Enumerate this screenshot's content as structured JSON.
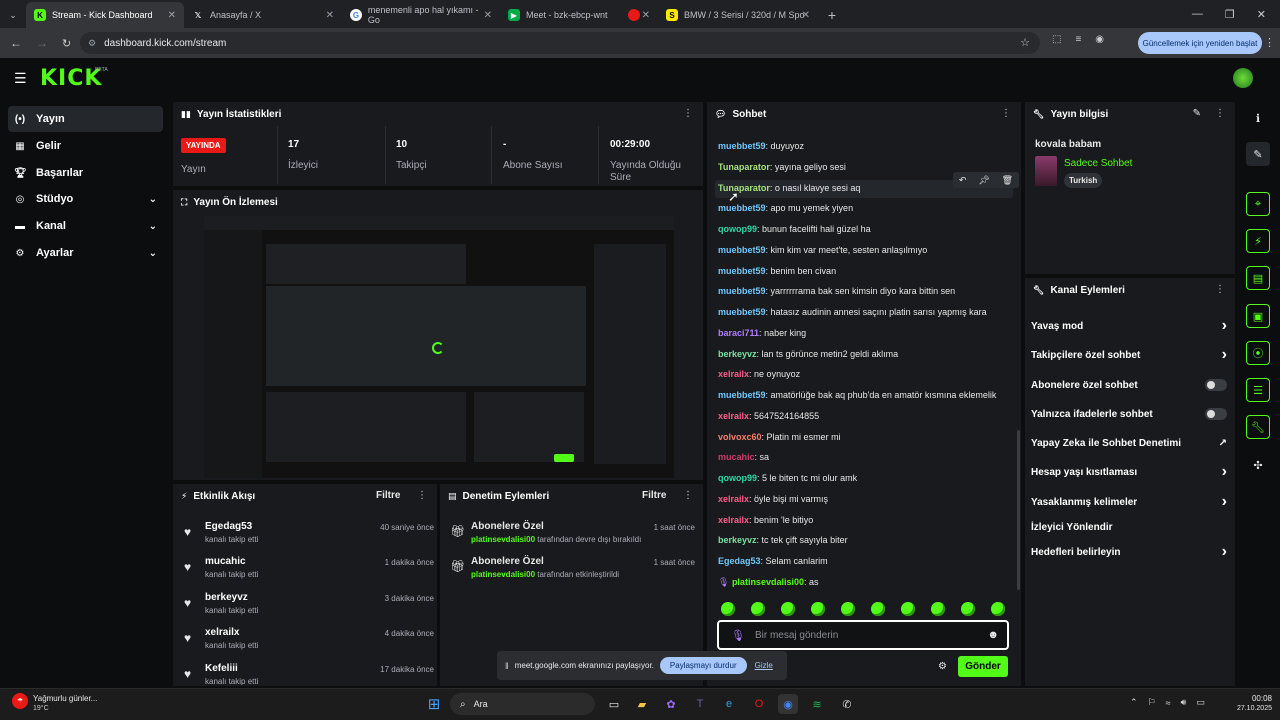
{
  "browser": {
    "tabs": [
      {
        "label": "Stream - Kick Dashboard",
        "icon": "kick-icon"
      },
      {
        "label": "Anasayfa / X",
        "icon": "x-icon"
      },
      {
        "label": "menemenli apo hal yıkamı - Go",
        "icon": "google-icon"
      },
      {
        "label": "Meet - bzk-ebcp-wnt",
        "icon": "meet-icon"
      },
      {
        "label": "",
        "icon": "record-icon"
      },
      {
        "label": "BMW / 3 Serisi / 320d / M Spo",
        "icon": "sahibinden-icon"
      }
    ],
    "url": "dashboard.kick.com/stream",
    "update_label": "Güncellemek için yeniden başlat"
  },
  "brand": {
    "logo": "KICK",
    "beta": "BETA"
  },
  "sidebar": {
    "items": [
      {
        "label": "Yayın",
        "icon": "broadcast-icon"
      },
      {
        "label": "Gelir",
        "icon": "revenue-icon"
      },
      {
        "label": "Başarılar",
        "icon": "trophy-icon"
      },
      {
        "label": "Stüdyo",
        "icon": "studio-icon"
      },
      {
        "label": "Kanal",
        "icon": "channel-icon"
      },
      {
        "label": "Ayarlar",
        "icon": "gear-icon"
      }
    ]
  },
  "stats": {
    "title": "Yayın İstatistikleri",
    "live_badge": "YAYINDA",
    "live_label": "Yayın",
    "viewers_value": "17",
    "viewers_label": "İzleyici",
    "followers_value": "10",
    "followers_label": "Takipçi",
    "subs_value": "-",
    "subs_label": "Abone Sayısı",
    "duration_value": "00:29:00",
    "duration_label": "Yayında Olduğu Süre"
  },
  "preview": {
    "title": "Yayın Ön İzlemesi"
  },
  "activity": {
    "title": "Etkinlik Akışı",
    "filter": "Filtre",
    "items": [
      {
        "name": "Egedag53",
        "sub": "kanalı takip etti",
        "time": "40 saniye önce"
      },
      {
        "name": "mucahic",
        "sub": "kanalı takip etti",
        "time": "1 dakika önce"
      },
      {
        "name": "berkeyvz",
        "sub": "kanalı takip etti",
        "time": "3 dakika önce"
      },
      {
        "name": "xelrailx",
        "sub": "kanalı takip etti",
        "time": "4 dakika önce"
      },
      {
        "name": "Kefeliii",
        "sub": "kanalı takip etti",
        "time": "17 dakika önce"
      }
    ]
  },
  "moderation": {
    "title": "Denetim Eylemleri",
    "filter": "Filtre",
    "items": [
      {
        "title": "Abonelere Özel",
        "user": "platinsevdalisi00",
        "action": " tarafından devre dışı bırakıldı",
        "time": "1 saat önce"
      },
      {
        "title": "Abonelere Özel",
        "user": "platinsevdalisi00",
        "action": " tarafından etkinleştirildi",
        "time": "1 saat önce"
      }
    ]
  },
  "chat": {
    "title": "Sohbet",
    "messages": [
      {
        "user": "muebbet59",
        "text": "duyuyoz",
        "color": "#6fc8ff"
      },
      {
        "user": "Tunaparator",
        "text": "yayına geliyo sesi",
        "color": "#a3e37a"
      },
      {
        "user": "Tunaparator",
        "text": "o nasıl klavye sesi aq",
        "color": "#a3e37a"
      },
      {
        "user": "muebbet59",
        "text": "apo mu yemek yiyen",
        "color": "#6fc8ff"
      },
      {
        "user": "qowop99",
        "text": "bunun facelifti hali güzel ha",
        "color": "#33d6a6"
      },
      {
        "user": "muebbet59",
        "text": "kim kim var meet'te, sesten anlaşılmıyo",
        "color": "#6fc8ff"
      },
      {
        "user": "muebbet59",
        "text": "benim ben civan",
        "color": "#6fc8ff"
      },
      {
        "user": "muebbet59",
        "text": "yarrrrrrama bak sen kimsin diyo kara bittin sen",
        "color": "#6fc8ff"
      },
      {
        "user": "muebbet59",
        "text": "hatasız audinin annesi saçını platin sarısı yapmış kara",
        "color": "#6fc8ff"
      },
      {
        "user": "baraci711",
        "text": "naber king",
        "color": "#b47cff"
      },
      {
        "user": "berkeyvz",
        "text": "lan ts görünce metin2 geldi aklıma",
        "color": "#7be0a1"
      },
      {
        "user": "xelrailx",
        "text": "ne oynuyoz",
        "color": "#ff5c8a"
      },
      {
        "user": "muebbet59",
        "text": "amatörlüğe bak aq phub'da en amatör kısmına eklemelik",
        "color": "#6fc8ff"
      },
      {
        "user": "xelrailx",
        "text": "5647524164855",
        "color": "#ff5c8a"
      },
      {
        "user": "volvoxc60",
        "text": "Platin mi esmer mi",
        "color": "#ff7b6b"
      },
      {
        "user": "mucahic",
        "text": "sa",
        "color": "#d03a6a"
      },
      {
        "user": "qowop99",
        "text": "5 le biten tc mi olur amk",
        "color": "#33d6a6"
      },
      {
        "user": "xelrailx",
        "text": "öyle bişi mi varmış",
        "color": "#ff5c8a"
      },
      {
        "user": "xelrailx",
        "text": "benim 'le bitiyo",
        "color": "#ff5c8a"
      },
      {
        "user": "berkeyvz",
        "text": "tc tek çift sayıyla biter",
        "color": "#7be0a1"
      },
      {
        "user": "Egedag53",
        "text": "Selam canlarim",
        "color": "#6fc8ff"
      },
      {
        "user": "platinsevdalisi00",
        "text": "as",
        "color": "#53fc18"
      }
    ],
    "input_placeholder": "Bir mesaj gönderin",
    "send_label": "Gönder"
  },
  "stream_info": {
    "title": "Yayın bilgisi",
    "stream_title": "kovala babam",
    "category": "Sadece Sohbet",
    "tag": "Turkish"
  },
  "channel_actions": {
    "title": "Kanal Eylemleri",
    "items": [
      {
        "label": "Yavaş mod",
        "control": "chevron"
      },
      {
        "label": "Takipçilere özel sohbet",
        "control": "chevron"
      },
      {
        "label": "Abonelere özel sohbet",
        "control": "toggle"
      },
      {
        "label": "Yalnızca ifadelerle sohbet",
        "control": "toggle"
      },
      {
        "label": "Yapay Zeka ile Sohbet Denetimi",
        "control": "external"
      },
      {
        "label": "Hesap yaşı kısıtlaması",
        "control": "chevron"
      },
      {
        "label": "Yasaklanmış kelimeler",
        "control": "chevron"
      },
      {
        "label": "İzleyici Yönlendir",
        "control": "none"
      },
      {
        "label": "Hedefleri belirleyin",
        "control": "chevron"
      }
    ]
  },
  "screenshare": {
    "text": "meet.google.com ekranınızı paylaşıyor.",
    "stop": "Paylaşmayı durdur",
    "hide": "Gizle"
  },
  "taskbar": {
    "weather_title": "Yağmurlu günler...",
    "weather_temp": "19°C",
    "search": "Ara",
    "time": "00:08",
    "date": "27.10.2025"
  },
  "colors": {
    "accent": "#53fc18",
    "live": "#e91916",
    "panel": "#181a1d"
  }
}
